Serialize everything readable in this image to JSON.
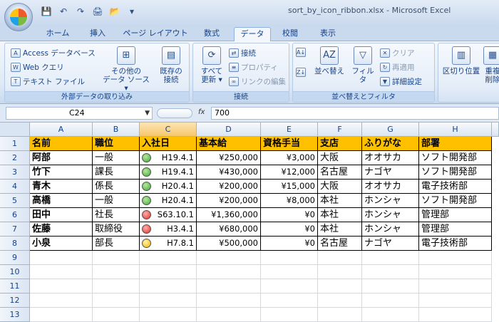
{
  "window": {
    "title": "sort_by_icon_ribbon.xlsx - Microsoft Excel"
  },
  "qat": {
    "save": "💾",
    "undo": "↶",
    "redo": "↷",
    "preview": "🖨",
    "open": "📂",
    "more": "▾"
  },
  "tabs": [
    "ホーム",
    "挿入",
    "ページ レイアウト",
    "数式",
    "データ",
    "校閲",
    "表示"
  ],
  "ribbon": {
    "external": {
      "label": "外部データの取り込み",
      "access": "Access データベース",
      "web": "Web クエリ",
      "text": "テキスト ファイル",
      "other_l1": "その他の",
      "other_l2": "データ ソース ▾",
      "existing_l1": "既存の",
      "existing_l2": "接続"
    },
    "connections": {
      "label": "接続",
      "refresh_l1": "すべて",
      "refresh_l2": "更新 ▾",
      "conn": "接続",
      "props": "プロパティ",
      "links": "リンクの編集"
    },
    "sort": {
      "label": "並べ替えとフィルタ",
      "sort": "並べ替え",
      "filter": "フィルタ",
      "clear": "クリア",
      "reapply": "再適用",
      "advanced": "詳細設定"
    },
    "tools": {
      "split": "区切り位置",
      "dup_l1": "重複",
      "dup_l2": "削除"
    }
  },
  "formula": {
    "namebox": "C24",
    "fx": "fx",
    "value": "700"
  },
  "columns": [
    "A",
    "B",
    "C",
    "D",
    "E",
    "F",
    "G",
    "H"
  ],
  "rows": [
    "1",
    "2",
    "3",
    "4",
    "5",
    "6",
    "7",
    "8",
    "9",
    "10",
    "11",
    "12",
    "13"
  ],
  "table": {
    "headers": [
      "名前",
      "職位",
      "入社日",
      "基本給",
      "資格手当",
      "支店",
      "ふりがな",
      "部署"
    ],
    "data": [
      {
        "name": "阿部",
        "pos": "一般",
        "icon": "green",
        "date": "H19.4.1",
        "salary": "¥250,000",
        "allow": "¥3,000",
        "branch": "大阪",
        "kana": "オオサカ",
        "dept": "ソフト開発部"
      },
      {
        "name": "竹下",
        "pos": "課長",
        "icon": "green",
        "date": "H19.4.1",
        "salary": "¥430,000",
        "allow": "¥12,000",
        "branch": "名古屋",
        "kana": "ナゴヤ",
        "dept": "ソフト開発部"
      },
      {
        "name": "青木",
        "pos": "係長",
        "icon": "green",
        "date": "H20.4.1",
        "salary": "¥200,000",
        "allow": "¥15,000",
        "branch": "大阪",
        "kana": "オオサカ",
        "dept": "電子技術部"
      },
      {
        "name": "高橋",
        "pos": "一般",
        "icon": "green",
        "date": "H20.4.1",
        "salary": "¥200,000",
        "allow": "¥8,000",
        "branch": "本社",
        "kana": "ホンシャ",
        "dept": "ソフト開発部"
      },
      {
        "name": "田中",
        "pos": "社長",
        "icon": "red",
        "date": "S63.10.1",
        "salary": "¥1,360,000",
        "allow": "¥0",
        "branch": "本社",
        "kana": "ホンシャ",
        "dept": "管理部"
      },
      {
        "name": "佐藤",
        "pos": "取締役",
        "icon": "red",
        "date": "H3.4.1",
        "salary": "¥680,000",
        "allow": "¥0",
        "branch": "本社",
        "kana": "ホンシャ",
        "dept": "管理部"
      },
      {
        "name": "小泉",
        "pos": "部長",
        "icon": "yellow",
        "date": "H7.8.1",
        "salary": "¥500,000",
        "allow": "¥0",
        "branch": "名古屋",
        "kana": "ナゴヤ",
        "dept": "電子技術部"
      }
    ]
  }
}
